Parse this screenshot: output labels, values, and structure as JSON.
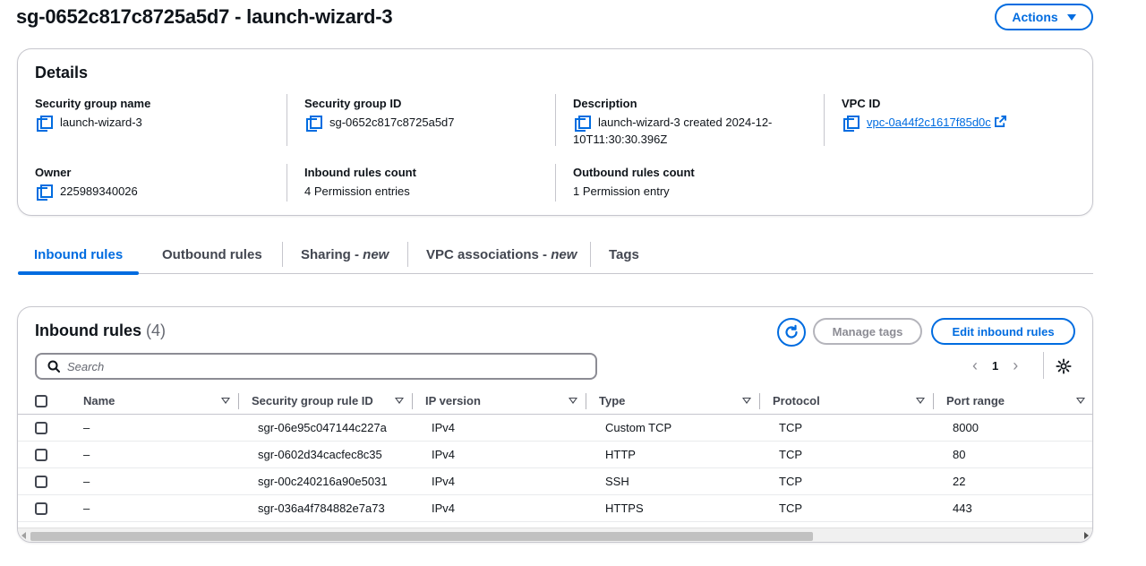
{
  "header": {
    "title": "sg-0652c817c8725a5d7 - launch-wizard-3",
    "actions_label": "Actions"
  },
  "details": {
    "title": "Details",
    "security_group_name": {
      "label": "Security group name",
      "value": "launch-wizard-3"
    },
    "security_group_id": {
      "label": "Security group ID",
      "value": "sg-0652c817c8725a5d7"
    },
    "description": {
      "label": "Description",
      "value_line1": "launch-wizard-3 created 2024-12-",
      "value_line2": "10T11:30:30.396Z"
    },
    "vpc_id": {
      "label": "VPC ID",
      "value": "vpc-0a44f2c1617f85d0c"
    },
    "owner": {
      "label": "Owner",
      "value": "225989340026"
    },
    "inbound_count": {
      "label": "Inbound rules count",
      "value": "4 Permission entries"
    },
    "outbound_count": {
      "label": "Outbound rules count",
      "value": "1 Permission entry"
    }
  },
  "tabs": [
    {
      "label": "Inbound rules",
      "suffix": "",
      "active": true
    },
    {
      "label": "Outbound rules",
      "suffix": "",
      "active": false
    },
    {
      "label": "Sharing - ",
      "suffix": "new",
      "active": false
    },
    {
      "label": "VPC associations - ",
      "suffix": "new",
      "active": false
    },
    {
      "label": "Tags",
      "suffix": "",
      "active": false
    }
  ],
  "inbound": {
    "title": "Inbound rules",
    "count": "(4)",
    "manage_tags_label": "Manage tags",
    "edit_label": "Edit inbound rules",
    "search_placeholder": "Search",
    "page": "1",
    "columns": [
      "Name",
      "Security group rule ID",
      "IP version",
      "Type",
      "Protocol",
      "Port range"
    ],
    "rows": [
      {
        "name": "–",
        "rule_id": "sgr-06e95c047144c227a",
        "ip_version": "IPv4",
        "type": "Custom TCP",
        "protocol": "TCP",
        "port_range": "8000"
      },
      {
        "name": "–",
        "rule_id": "sgr-0602d34cacfec8c35",
        "ip_version": "IPv4",
        "type": "HTTP",
        "protocol": "TCP",
        "port_range": "80"
      },
      {
        "name": "–",
        "rule_id": "sgr-00c240216a90e5031",
        "ip_version": "IPv4",
        "type": "SSH",
        "protocol": "TCP",
        "port_range": "22"
      },
      {
        "name": "–",
        "rule_id": "sgr-036a4f784882e7a73",
        "ip_version": "IPv4",
        "type": "HTTPS",
        "protocol": "TCP",
        "port_range": "443"
      }
    ]
  },
  "colors": {
    "accent": "#006ce0",
    "text": "#0f141a",
    "border": "#c6c6cd",
    "disabled": "#8c8c94"
  },
  "icons": [
    "copy-icon",
    "external-link-icon",
    "refresh-icon",
    "search-icon",
    "settings-gear-icon",
    "chevron-left-icon",
    "chevron-right-icon",
    "sort-icon",
    "caret-down-icon"
  ]
}
